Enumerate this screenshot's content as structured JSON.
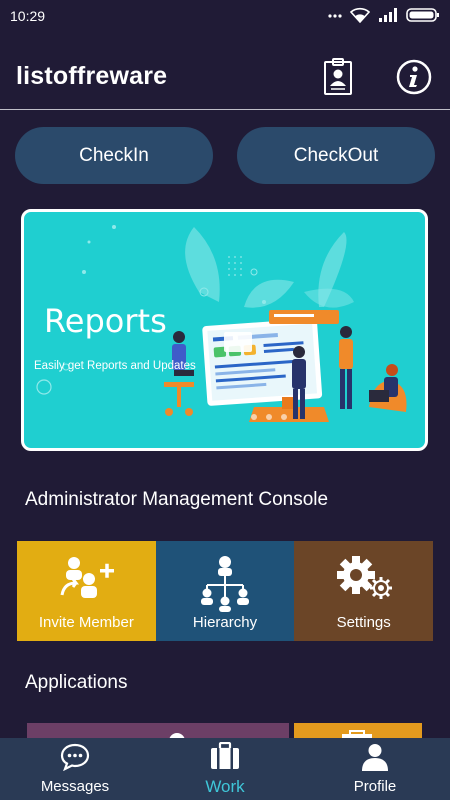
{
  "status": {
    "time": "10:29",
    "battery_icon": "battery-icon",
    "signal_icon": "signal-icon",
    "wifi_icon": "wifi-icon"
  },
  "app_bar": {
    "title": "listoffreware",
    "badge_icon": "id-badge-icon",
    "info_icon": "info-icon"
  },
  "attendance": {
    "checkin_label": "CheckIn",
    "checkout_label": "CheckOut"
  },
  "banner": {
    "title": "Reports",
    "subtitle": "Easily get Reports and Updates",
    "bg_color": "#1fcfd0"
  },
  "admin": {
    "heading": "Administrator Management Console",
    "tiles": [
      {
        "label": "Invite Member",
        "icon": "add-member-icon",
        "color": "#e2ad12"
      },
      {
        "label": "Hierarchy",
        "icon": "hierarchy-icon",
        "color": "#1f5278"
      },
      {
        "label": "Settings",
        "icon": "gears-icon",
        "color": "#6b4527"
      }
    ]
  },
  "applications": {
    "heading": "Applications"
  },
  "bottom_nav": {
    "items": [
      {
        "label": "Messages",
        "icon": "chat-icon",
        "active": false
      },
      {
        "label": "Work",
        "icon": "briefcase-icon",
        "active": true
      },
      {
        "label": "Profile",
        "icon": "person-icon",
        "active": false
      }
    ],
    "active_color": "#3fc6d8"
  }
}
